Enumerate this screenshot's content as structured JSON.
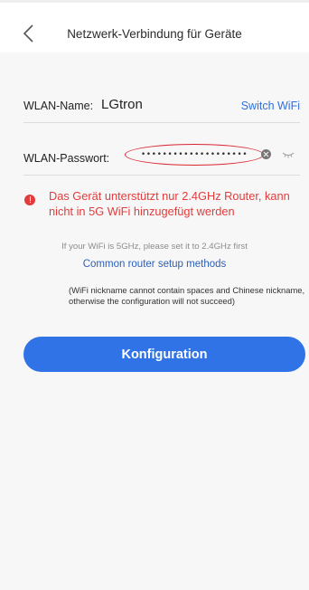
{
  "header": {
    "title": "Netzwerk-Verbindung für Geräte",
    "back_icon": "chevron-left-icon"
  },
  "wifi": {
    "ssid_label": "WLAN-Name:",
    "ssid_value": "LGtron",
    "switch_label": "Switch WiFi",
    "password_label": "WLAN-Passwort:",
    "password_value": "••••••••••••••••••••",
    "clear_icon": "clear-icon",
    "visibility_icon": "eye-closed-icon"
  },
  "warning": {
    "icon": "alert-icon",
    "text": "Das Gerät unterstützt nur 2.4GHz Router, kann nicht in 5G WiFi hinzugefügt werden"
  },
  "hints": {
    "five_ghz": "If your WiFi is 5GHz, please set it to 2.4GHz first",
    "setup_link": "Common router setup methods",
    "nickname_note": "(WiFi nickname cannot contain spaces and Chinese nickname, otherwise the configuration will not succeed)"
  },
  "action": {
    "configure_label": "Konfiguration"
  },
  "colors": {
    "accent": "#2f73e6",
    "link": "#2f6fe0",
    "warning": "#e23c3c",
    "highlight_circle": "#d9262f"
  }
}
